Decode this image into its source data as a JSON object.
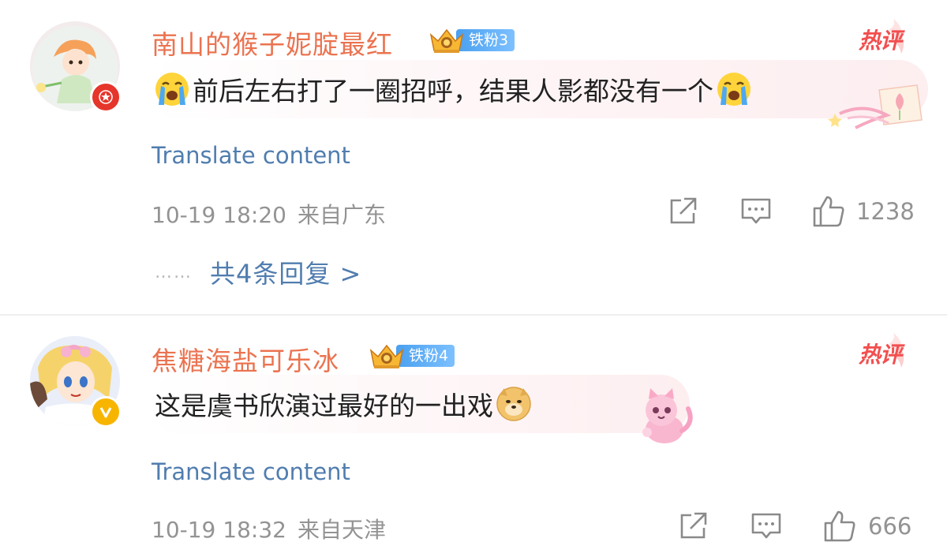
{
  "comments": [
    {
      "username": "南山的猴子妮腚最红",
      "fan_badge": "铁粉3",
      "hot_tag": "热评",
      "text": "前后左右打了一圈招呼，结果人影都没有一个",
      "translate": "Translate content",
      "time": "10-19 18:20",
      "location": "来自广东",
      "likes": "1238",
      "replies": "共4条回复 >",
      "leading_emoji": "crying-face-icon",
      "trailing_emoji": "crying-face-icon",
      "avatar_badge": "red-star-icon"
    },
    {
      "username": "焦糖海盐可乐冰",
      "fan_badge": "铁粉4",
      "hot_tag": "热评",
      "text": "这是虞书欣演过最好的一出戏",
      "translate": "Translate content",
      "time": "10-19 18:32",
      "location": "来自天津",
      "likes": "666",
      "trailing_emoji": "doge-icon",
      "avatar_badge": "yellow-v-icon"
    }
  ],
  "replies_dots": "……",
  "colors": {
    "username": "#eb7350",
    "link": "#507daf",
    "meta": "#939393",
    "hot": "#f24f4f",
    "fan_badge": "#4aa0ef"
  }
}
